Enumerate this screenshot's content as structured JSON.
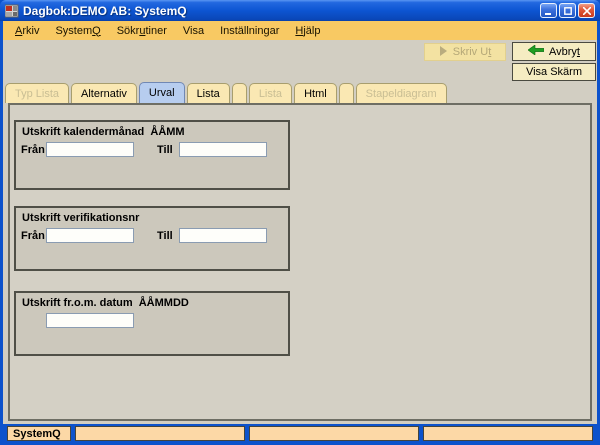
{
  "window": {
    "title": "Dagbok:DEMO AB: SystemQ"
  },
  "menu": {
    "items": [
      {
        "pre": "",
        "key": "A",
        "post": "rkiv"
      },
      {
        "pre": "System",
        "key": "Q",
        "post": ""
      },
      {
        "pre": "Sökr",
        "key": "u",
        "post": "tiner"
      },
      {
        "pre": "Visa",
        "key": "",
        "post": ""
      },
      {
        "pre": "Inställningar",
        "key": "",
        "post": ""
      },
      {
        "pre": "",
        "key": "H",
        "post": "jälp"
      }
    ]
  },
  "toolbar": {
    "print_button": {
      "pre": "Skriv U",
      "key": "t",
      "post": "",
      "state": "disabled"
    },
    "cancel_button": {
      "pre": "Avbry",
      "key": "t",
      "post": ""
    },
    "show_screen_button": {
      "label": "Visa Skärm"
    }
  },
  "tabs": [
    {
      "label": "Typ Lista",
      "state": "disabled"
    },
    {
      "label": "Alternativ",
      "state": "normal"
    },
    {
      "label": "Urval",
      "state": "selected"
    },
    {
      "label": "Lista",
      "state": "normal"
    },
    {
      "label": "",
      "state": "spacer"
    },
    {
      "label": "Lista",
      "state": "disabled"
    },
    {
      "label": "Html",
      "state": "normal"
    },
    {
      "label": "",
      "state": "spacer"
    },
    {
      "label": "Stapeldiagram",
      "state": "disabled"
    }
  ],
  "groups": [
    {
      "title": "Utskrift kalendermånad  ÅÅMM",
      "fields": [
        {
          "label": "Från",
          "value": ""
        },
        {
          "label": "Till",
          "value": ""
        }
      ]
    },
    {
      "title": "Utskrift verifikationsnr",
      "fields": [
        {
          "label": "Från",
          "value": ""
        },
        {
          "label": "Till",
          "value": ""
        }
      ]
    },
    {
      "title": "Utskrift fr.o.m. datum  ÅÅMMDD",
      "fields": [
        {
          "label": "",
          "value": ""
        }
      ]
    }
  ],
  "statusbar": {
    "panels": [
      "SystemQ",
      "",
      "",
      ""
    ]
  },
  "colors": {
    "titlebar_blue": "#0C52CC",
    "menu_orange": "#F8C963",
    "panel_gray": "#D4D0C5",
    "groupbox_gray": "#CCC8BC",
    "tab_beige": "#FAE8B3",
    "tab_selected_blue": "#B7CDEF",
    "button_beige": "#F5ECC2",
    "status_peach": "#FCD8A6",
    "arrow_green": "#1E9E22",
    "close_red": "#D9482E"
  }
}
